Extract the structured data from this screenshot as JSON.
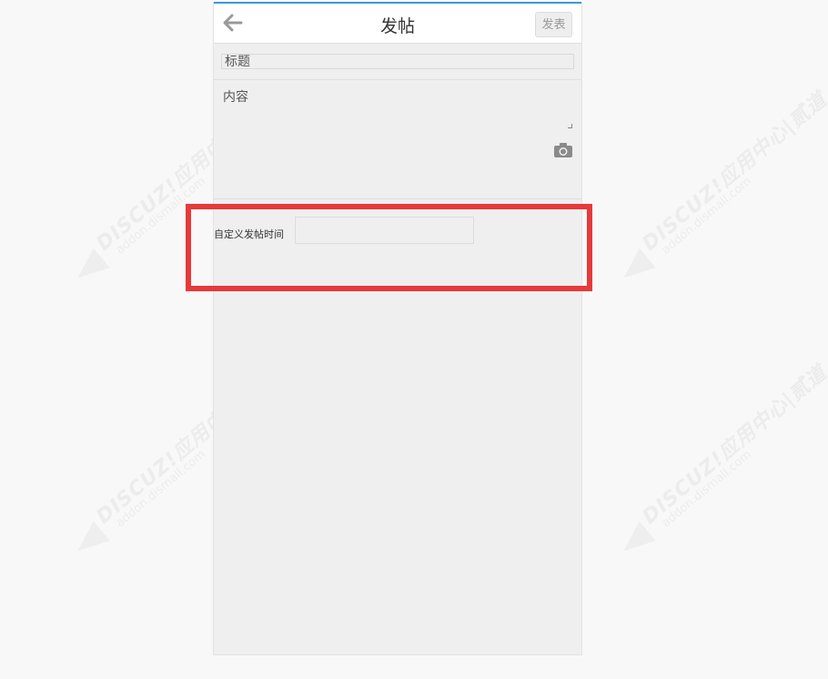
{
  "header": {
    "back_icon": "arrow-left-icon",
    "title": "发帖",
    "publish_label": "发表"
  },
  "form": {
    "title_placeholder": "标题",
    "content_placeholder": "内容",
    "camera_icon": "camera-icon",
    "custom_time_label": "自定义发帖时间",
    "custom_time_value": ""
  },
  "watermark": {
    "brand": "DISCUZ!应用中心|贰道",
    "url": "addon.dismall.com"
  },
  "colors": {
    "accent": "#3a9ad9",
    "highlight": "#e8393a",
    "background": "#efefef"
  }
}
